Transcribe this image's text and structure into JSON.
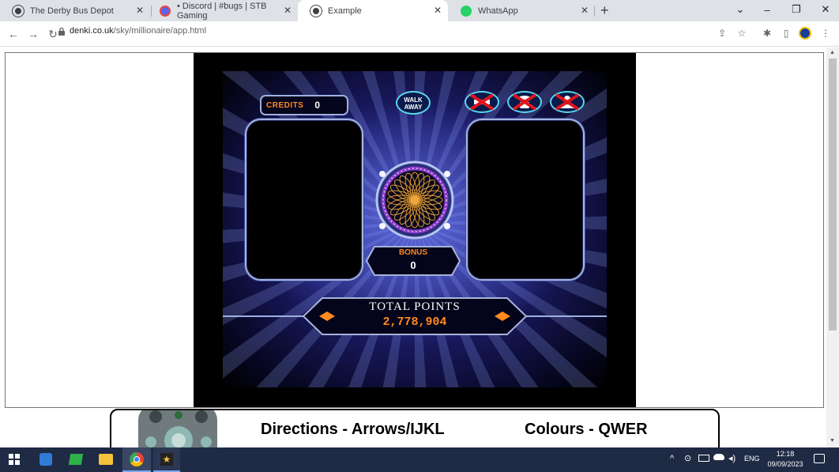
{
  "browser": {
    "tabs": [
      {
        "title": "The Derby Bus Depot",
        "favicon": "globe-icon",
        "active": false
      },
      {
        "title": "• Discord | #bugs | STB Gaming",
        "favicon": "discord-icon",
        "active": false
      },
      {
        "title": "Example",
        "favicon": "globe-icon",
        "active": true
      },
      {
        "title": "WhatsApp",
        "favicon": "whatsapp-icon",
        "active": false
      }
    ],
    "new_tab_label": "+",
    "url_host": "denki.co.uk",
    "url_path": "/sky/millionaire/app.html"
  },
  "game": {
    "credits_label": "CREDITS",
    "credits_value": "0",
    "walk_away_line1": "WALK",
    "walk_away_line2": "AWAY",
    "bonus_label": "BONUS",
    "bonus_value": "0",
    "total_label": "TOTAL POINTS",
    "total_value": "2,778,904",
    "lifelines": [
      "50:50",
      "phone-a-friend",
      "ask-the-audience"
    ],
    "lifelines_used": [
      true,
      true,
      true
    ]
  },
  "instructions": {
    "directions": "Directions - Arrows/IJKL",
    "colours": "Colours - QWER"
  },
  "taskbar": {
    "language": "ENG",
    "time": "12:18",
    "date": "09/09/2023"
  },
  "colors": {
    "accent_orange": "#ff8a1f",
    "frame_blue": "#9fb0e0",
    "taskbar": "#1f2a44"
  }
}
